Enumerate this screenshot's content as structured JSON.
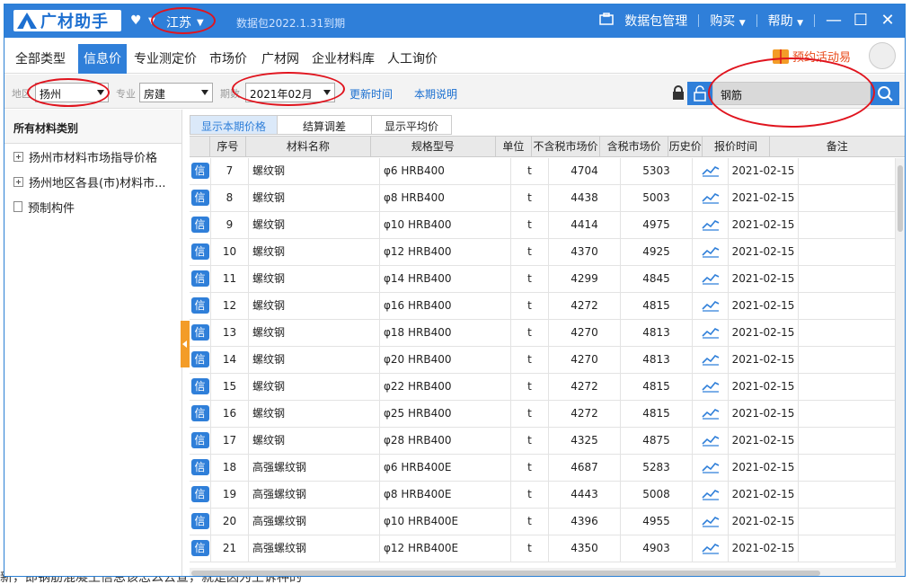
{
  "app": {
    "logo_text": "广材助手",
    "province": "江苏",
    "expire_notice": "数据包2022.1.31到期",
    "package_mgmt": "数据包管理",
    "buy": "购买",
    "help": "帮助"
  },
  "nav": {
    "tabs": [
      "全部类型",
      "信息价",
      "专业测定价",
      "市场价",
      "广材网",
      "企业材料库",
      "人工询价"
    ],
    "active_index": 1,
    "promo": "预约活动易"
  },
  "filters": {
    "region_label": "地区",
    "region_value": "扬州",
    "specialty_label": "专业",
    "specialty_value": "房建",
    "period_label": "期数",
    "period_value": "2021年02月",
    "update_time_link": "更新时间",
    "period_note_link": "本期说明",
    "search_value": "钢筋"
  },
  "sidebar": {
    "header": "所有材料类别",
    "items": [
      {
        "label": "扬州市材料市场指导价格",
        "icon": "expand-icon"
      },
      {
        "label": "扬州地区各县(市)材料市...",
        "icon": "expand-icon"
      },
      {
        "label": "预制构件",
        "icon": "document-icon"
      }
    ]
  },
  "subtabs": [
    "显示本期价格",
    "结算调差",
    "显示平均价"
  ],
  "table": {
    "columns": [
      "",
      "序号",
      "材料名称",
      "规格型号",
      "单位",
      "不含税市场价",
      "含税市场价",
      "历史价",
      "报价时间",
      "备注"
    ],
    "badge_label": "信",
    "rows": [
      {
        "no": "7",
        "name": "螺纹钢",
        "spec": "φ6 HRB400",
        "unit": "t",
        "price_ex": "4704",
        "price_in": "5303",
        "date": "2021-02-15"
      },
      {
        "no": "8",
        "name": "螺纹钢",
        "spec": "φ8 HRB400",
        "unit": "t",
        "price_ex": "4438",
        "price_in": "5003",
        "date": "2021-02-15"
      },
      {
        "no": "9",
        "name": "螺纹钢",
        "spec": "φ10 HRB400",
        "unit": "t",
        "price_ex": "4414",
        "price_in": "4975",
        "date": "2021-02-15"
      },
      {
        "no": "10",
        "name": "螺纹钢",
        "spec": "φ12 HRB400",
        "unit": "t",
        "price_ex": "4370",
        "price_in": "4925",
        "date": "2021-02-15"
      },
      {
        "no": "11",
        "name": "螺纹钢",
        "spec": "φ14 HRB400",
        "unit": "t",
        "price_ex": "4299",
        "price_in": "4845",
        "date": "2021-02-15"
      },
      {
        "no": "12",
        "name": "螺纹钢",
        "spec": "φ16 HRB400",
        "unit": "t",
        "price_ex": "4272",
        "price_in": "4815",
        "date": "2021-02-15"
      },
      {
        "no": "13",
        "name": "螺纹钢",
        "spec": "φ18 HRB400",
        "unit": "t",
        "price_ex": "4270",
        "price_in": "4813",
        "date": "2021-02-15"
      },
      {
        "no": "14",
        "name": "螺纹钢",
        "spec": "φ20 HRB400",
        "unit": "t",
        "price_ex": "4270",
        "price_in": "4813",
        "date": "2021-02-15"
      },
      {
        "no": "15",
        "name": "螺纹钢",
        "spec": "φ22 HRB400",
        "unit": "t",
        "price_ex": "4272",
        "price_in": "4815",
        "date": "2021-02-15"
      },
      {
        "no": "16",
        "name": "螺纹钢",
        "spec": "φ25 HRB400",
        "unit": "t",
        "price_ex": "4272",
        "price_in": "4815",
        "date": "2021-02-15"
      },
      {
        "no": "17",
        "name": "螺纹钢",
        "spec": "φ28 HRB400",
        "unit": "t",
        "price_ex": "4325",
        "price_in": "4875",
        "date": "2021-02-15"
      },
      {
        "no": "18",
        "name": "高强螺纹钢",
        "spec": "φ6 HRB400E",
        "unit": "t",
        "price_ex": "4687",
        "price_in": "5283",
        "date": "2021-02-15"
      },
      {
        "no": "19",
        "name": "高强螺纹钢",
        "spec": "φ8 HRB400E",
        "unit": "t",
        "price_ex": "4443",
        "price_in": "5008",
        "date": "2021-02-15"
      },
      {
        "no": "20",
        "name": "高强螺纹钢",
        "spec": "φ10 HRB400E",
        "unit": "t",
        "price_ex": "4396",
        "price_in": "4955",
        "date": "2021-02-15"
      },
      {
        "no": "21",
        "name": "高强螺纹钢",
        "spec": "φ12 HRB400E",
        "unit": "t",
        "price_ex": "4350",
        "price_in": "4903",
        "date": "2021-02-15"
      }
    ]
  },
  "background_text": "新，即钢筋混凝土信息该怎么去查，就是因为上诉种的"
}
